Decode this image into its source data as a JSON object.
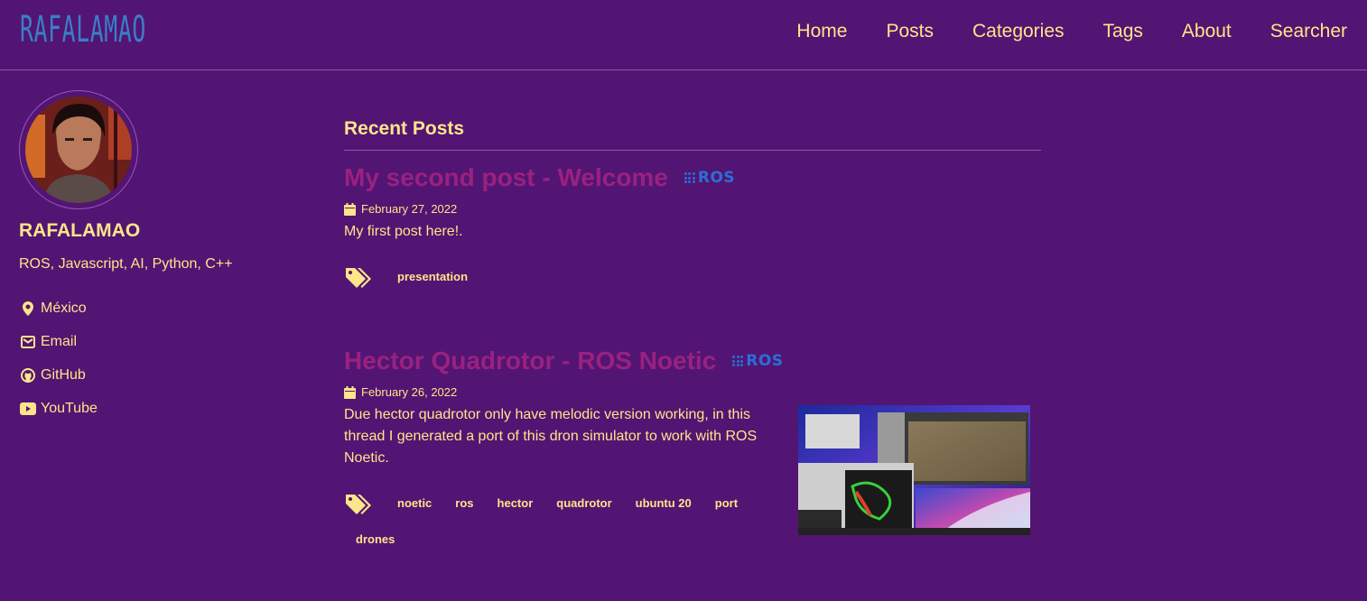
{
  "site": {
    "logo_text": "RAFALAMAO",
    "nav": [
      "Home",
      "Posts",
      "Categories",
      "Tags",
      "About",
      "Searcher"
    ]
  },
  "author": {
    "name": "RAFALAMAO",
    "bio": "ROS, Javascript, AI, Python, C++",
    "links": [
      {
        "icon": "map-marker-icon",
        "label": "México"
      },
      {
        "icon": "envelope-icon",
        "label": "Email"
      },
      {
        "icon": "github-icon",
        "label": "GitHub"
      },
      {
        "icon": "youtube-icon",
        "label": "YouTube"
      }
    ]
  },
  "main": {
    "section_title": "Recent Posts",
    "posts": [
      {
        "title": "My second post - Welcome",
        "category": "ROS",
        "date": "February 27, 2022",
        "excerpt": "My first post here!.",
        "tags": [
          "presentation"
        ]
      },
      {
        "title": "Hector Quadrotor - ROS Noetic",
        "category": "ROS",
        "date": "February 26, 2022",
        "excerpt": "Due hector quadrotor only have melodic version working, in this thread I generated a port of this dron simulator to work with ROS Noetic.",
        "tags": [
          "noetic",
          "ros",
          "hector",
          "quadrotor",
          "ubuntu 20",
          "port",
          "drones"
        ]
      }
    ]
  },
  "colors": {
    "background": "#521573",
    "text": "#fde58a",
    "post_title": "#9a2180",
    "ros_badge": "#2a6fd6",
    "logo": "#3a7fc8"
  }
}
